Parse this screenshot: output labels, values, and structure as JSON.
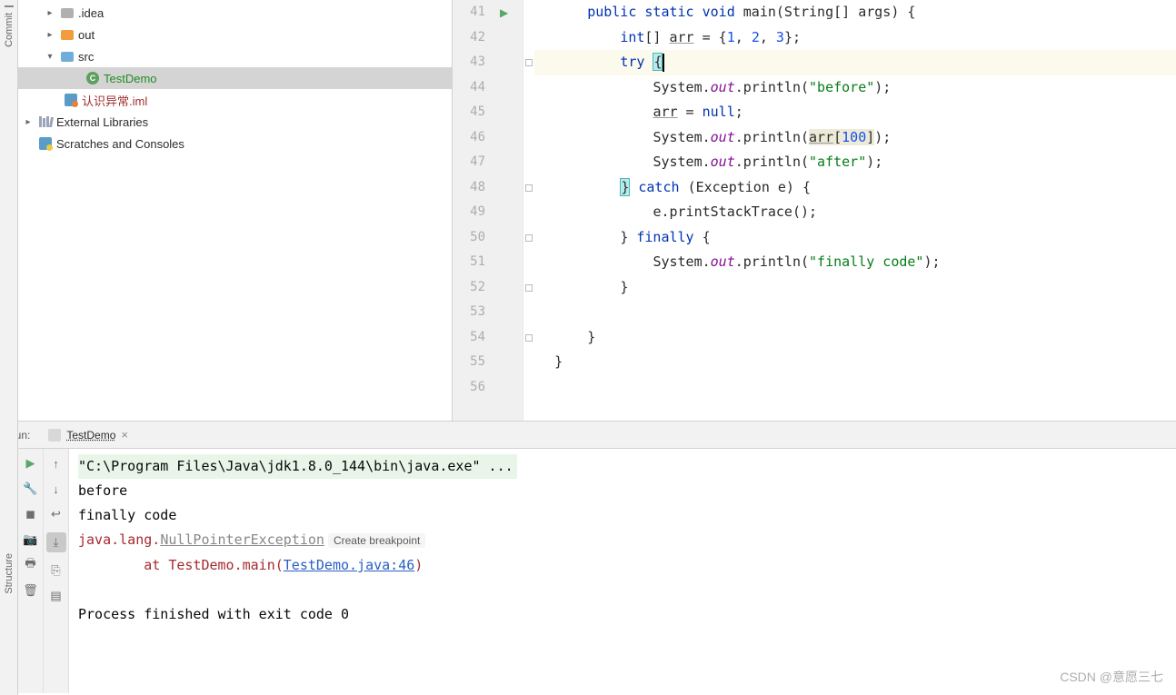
{
  "sidebar_tabs": {
    "commit": "Commit",
    "structure": "Structure"
  },
  "tree": {
    "idea": ".idea",
    "out": "out",
    "src": "src",
    "class_file": "TestDemo",
    "iml_file": "认识异常.iml",
    "ext_lib": "External Libraries",
    "scratches": "Scratches and Consoles"
  },
  "class_letter": "C",
  "gutter": {
    "start": 41,
    "end": 56
  },
  "code": {
    "l41_a": "public static void",
    "l41_b": "main(String[] args) {",
    "l42_a": "int",
    "l42_b": "[] ",
    "l42_arr": "arr",
    "l42_c": " = {",
    "l42_n1": "1",
    "l42_n2": "2",
    "l42_n3": "3",
    "l42_d": "};",
    "l43_try": "try",
    "l43_brace": "{",
    "l44_a": "System.",
    "l44_out": "out",
    "l44_b": ".println(",
    "l44_s": "\"before\"",
    "l44_c": ");",
    "l45_arr": "arr",
    "l45_a": " = ",
    "l45_null": "null",
    "l45_b": ";",
    "l46_a": "System.",
    "l46_out": "out",
    "l46_b": ".println(",
    "l46_arr": "arr",
    "l46_lb": "[",
    "l46_n": "100",
    "l46_rb": "]",
    "l46_c": ");",
    "l47_a": "System.",
    "l47_out": "out",
    "l47_b": ".println(",
    "l47_s": "\"after\"",
    "l47_c": ");",
    "l48_rb": "}",
    "l48_catch": "catch",
    "l48_c": "(Exception e) {",
    "l49": "e.printStackTrace();",
    "l50_a": "} ",
    "l50_fin": "finally",
    "l50_b": " {",
    "l51_a": "System.",
    "l51_out": "out",
    "l51_b": ".println(",
    "l51_s": "\"finally code\"",
    "l51_c": ");",
    "l52": "}",
    "l53": "",
    "l54": "}",
    "l55": "}"
  },
  "run": {
    "label": "Run:",
    "tab_name": "TestDemo",
    "close": "×"
  },
  "console": {
    "cmd": "\"C:\\Program Files\\Java\\jdk1.8.0_144\\bin\\java.exe\" ...",
    "out1": "before",
    "out2": "finally code",
    "exc_pre": "java.lang.",
    "exc_name": "NullPointerException",
    "breakpoint": "Create breakpoint",
    "at": "\tat TestDemo.main(",
    "file_link": "TestDemo.java:46",
    "at_end": ")",
    "exit": "Process finished with exit code 0"
  },
  "watermark": "CSDN @意愿三七"
}
